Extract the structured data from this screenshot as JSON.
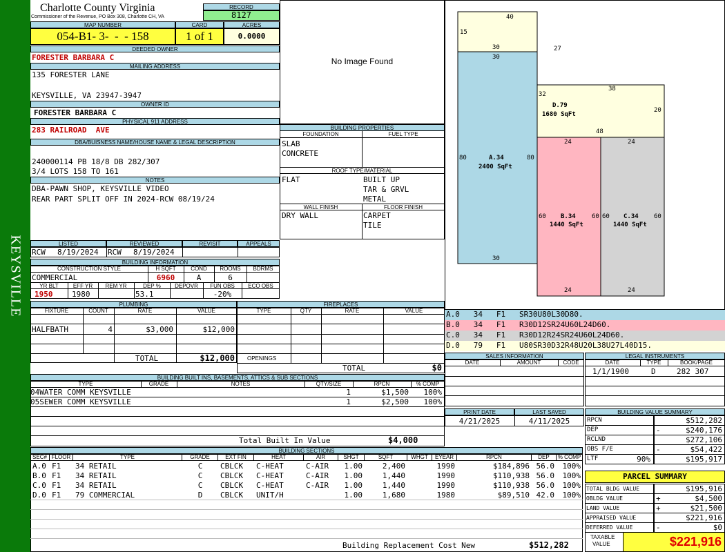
{
  "side_label": "KEYSVILLE",
  "header": {
    "county": "Charlotte County Virginia",
    "commissioner": "Commissioner of the Revenue, PO Box 308, Charlotte CH, VA",
    "record_label": "RECORD",
    "record": "8127"
  },
  "map": {
    "map_label": "MAP NUMBER",
    "map_number": "054-B1- 3-  -  - 158",
    "card_label": "CARD",
    "card": "1 of 1",
    "acres_label": "ACRES",
    "acres": "0.0000"
  },
  "owner": {
    "deeded_label": "DEEDED OWNER",
    "deeded_owner": "FORESTER BARBARA C",
    "mailing_label": "MAILING ADDRESS",
    "addr1": "135 FORESTER LANE",
    "addr2": "KEYSVILLE, VA 23947-3947",
    "owner_id_label": "OWNER ID",
    "owner_id": "FORESTER BARBARA C",
    "physical_label": "PHYSICAL 911 ADDRESS",
    "physical": "283 RAILROAD  AVE"
  },
  "legal": {
    "label": "DBA/BUISNESS NAME/HOUSE NAME & LEGAL DESCRIPTION",
    "line1": "240000114 PB 18/8 DB 282/307",
    "line2": "3/4 LOTS 158 TO 161"
  },
  "notes": {
    "label": "NOTES",
    "line1": "DBA-PAWN SHOP, KEYSVILLE VIDEO",
    "line2": "REAR PART SPLIT OFF IN 2024-RCW 08/19/24"
  },
  "image": {
    "text": "No Image Found"
  },
  "building_props": {
    "label": "BUILDING PROPERTIES",
    "foundation_label": "FOUNDATION",
    "fuel_label": "FUEL TYPE",
    "foundation1": "SLAB",
    "foundation2": "CONCRETE",
    "roof_label": "ROOF TYPE/MATERIAL",
    "roof1": "FLAT",
    "roof2": "BUILT UP",
    "roof3": "TAR & GRVL",
    "roof4": "METAL",
    "wall_label": "WALL FINISH",
    "floor_label": "FLOOR FINISH",
    "wall1": "DRY WALL",
    "floor1": "CARPET",
    "floor2": "TILE"
  },
  "review": {
    "listed_label": "LISTED",
    "reviewed_label": "REVIEWED",
    "revisit_label": "REVISIT",
    "appeals_label": "APPEALS",
    "listed_by": "RCW",
    "listed_date": "8/19/2024",
    "reviewed_by": "RCW",
    "reviewed_date": "8/19/2024"
  },
  "building_info": {
    "label": "BUILDING INFORMATION",
    "cs_label": "CONSTRUCTION STYLE",
    "hsqft_label": "H SQFT",
    "cond_label": "COND",
    "rooms_label": "ROOMS",
    "bdrms_label": "BDRMS",
    "style": "COMMERCIAL",
    "hsqft": "6960",
    "cond": "A",
    "rooms": "6",
    "yrblt_label": "YR BLT",
    "effyr_label": "EFF YR",
    "remyr_label": "REM YR",
    "dep_label": "DEP %",
    "depovr_label": "DEPOVR",
    "funobs_label": "FUN OBS",
    "ecoobs_label": "ECO OBS",
    "yrblt": "1950",
    "effyr": "1980",
    "dep": "53.1",
    "funobs": "-20%"
  },
  "plumbing": {
    "label": "PLUMBING",
    "h_fixture": "FIXTURE",
    "h_count": "COUNT",
    "h_rate": "RATE",
    "h_value": "VALUE",
    "fixture": "HALFBATH",
    "count": "4",
    "rate": "$3,000",
    "value": "$12,000",
    "total_label": "TOTAL",
    "total": "$12,000"
  },
  "fireplaces": {
    "label": "FIREPLACES",
    "h_type": "TYPE",
    "h_qty": "QTY",
    "h_rate": "RATE",
    "h_value": "VALUE",
    "openings_label": "OPENINGS",
    "total_label": "TOTAL",
    "total": "$0"
  },
  "builtins": {
    "label": "BUILDING BUILT INS, BASEMENTS, ATTICS & SUB SECTIONS",
    "h_type": "TYPE",
    "h_grade": "GRADE",
    "h_notes": "NOTES",
    "h_qty": "QTY/SIZE",
    "h_rpcn": "RPCN",
    "h_comp": "% COMP",
    "rows": [
      {
        "type": "04WATER COMM KEYSVILLE",
        "qty": "1",
        "rpcn": "$1,500",
        "comp": "100%"
      },
      {
        "type": "05SEWER COMM KEYSVILLE",
        "qty": "1",
        "rpcn": "$2,500",
        "comp": "100%"
      }
    ],
    "total_label": "Total Built In Value",
    "total": "$4,000"
  },
  "sections": {
    "label": "BUILDING SECTIONS",
    "headers": [
      "SEC#",
      "FLOOR",
      "TYPE",
      "GRADE",
      "EXT FIN",
      "HEAT",
      "AIR",
      "SHGT",
      "SQFT",
      "WHGT",
      "EYEAR",
      "RPCN",
      "DEP",
      "% COMP"
    ],
    "rows": [
      [
        "A.0",
        "F1",
        "34 RETAIL",
        "C",
        "CBLCK",
        "C-HEAT",
        "C-AIR",
        "1.00",
        "2,400",
        "",
        "1990",
        "$184,896",
        "56.0",
        "100%"
      ],
      [
        "B.0",
        "F1",
        "34 RETAIL",
        "C",
        "CBLCK",
        "C-HEAT",
        "C-AIR",
        "1.00",
        "1,440",
        "",
        "1990",
        "$110,938",
        "56.0",
        "100%"
      ],
      [
        "C.0",
        "F1",
        "34 RETAIL",
        "C",
        "CBLCK",
        "C-HEAT",
        "C-AIR",
        "1.00",
        "1,440",
        "",
        "1990",
        "$110,938",
        "56.0",
        "100%"
      ],
      [
        "D.0",
        "F1",
        "79 COMMERCIAL",
        "D",
        "CBLCK",
        "UNIT/H",
        "",
        "1.00",
        "1,680",
        "",
        "1980",
        "$89,510",
        "42.0",
        "100%"
      ]
    ],
    "brcn_label": "Building Replacement Cost New",
    "brcn": "$512,282"
  },
  "sketch": {
    "labels": [
      {
        "t": "40"
      },
      {
        "t": "15"
      },
      {
        "t": "30"
      },
      {
        "t": "27"
      },
      {
        "t": "30"
      },
      {
        "t": "32"
      },
      {
        "t": "38"
      },
      {
        "t": "D.79"
      },
      {
        "t": "1680 SqFt"
      },
      {
        "t": "20"
      },
      {
        "t": "48"
      },
      {
        "t": "24"
      },
      {
        "t": "24"
      },
      {
        "t": "80"
      },
      {
        "t": "A.34"
      },
      {
        "t": "2400 SqFt"
      },
      {
        "t": "80"
      },
      {
        "t": "60"
      },
      {
        "t": "B.34"
      },
      {
        "t": "60"
      },
      {
        "t": "60"
      },
      {
        "t": "C.34"
      },
      {
        "t": "60"
      },
      {
        "t": "1440 SqFt"
      },
      {
        "t": "1440 SqFt"
      },
      {
        "t": "30"
      },
      {
        "t": "24"
      },
      {
        "t": "24"
      }
    ],
    "colors": {
      "A": "#add8e6",
      "B": "#ffb6c1",
      "C": "#d3d3d3",
      "D": "#ffffe0"
    }
  },
  "calls": [
    {
      "text": "A.0   34   F1   SR30U80L30D80.",
      "color": "#add8e6"
    },
    {
      "text": "B.0   34   F1   R30D12SR24U60L24D60.",
      "color": "#ffb6c1"
    },
    {
      "text": "C.0   34   F1   R30D12R24SR24U60L24D60.",
      "color": "#d3d3d3"
    },
    {
      "text": "D.0   79   F1   U80SR30D32R48U20L38U27L40D15.",
      "color": "#ffffe0"
    }
  ],
  "sales": {
    "label": "SALES INFORMATION",
    "h_date": "DATE",
    "h_amount": "AMOUNT",
    "h_code": "CODE"
  },
  "legal_instr": {
    "label": "LEGAL INSTRUMENTS",
    "h_date": "DATE",
    "h_type": "TYPE",
    "h_book": "BOOK/PAGE",
    "date": "1/1/1900",
    "type": "D",
    "book": "282 307"
  },
  "print": {
    "print_label": "PRINT DATE",
    "saved_label": "LAST SAVED",
    "print_date": "4/21/2025",
    "saved_date": "4/11/2025"
  },
  "bvs": {
    "label": "BUILDING VALUE SUMMARY",
    "rows": [
      {
        "k": "RPCN",
        "s": "",
        "v": "$512,282"
      },
      {
        "k": "DEP",
        "s": "-",
        "v": "$240,176"
      },
      {
        "k": "RCLND",
        "s": "",
        "v": "$272,106"
      },
      {
        "k": "OBS F/E",
        "s": "-",
        "v": "$54,422"
      },
      {
        "k": "LTF",
        "p": "90%",
        "s": "",
        "v": "$195,917"
      }
    ]
  },
  "parcel": {
    "label": "PARCEL SUMMARY",
    "rows": [
      {
        "k": "TOTAL BLDG VALUE",
        "s": "",
        "v": "$195,916"
      },
      {
        "k": "OBLDG VALUE",
        "s": "+",
        "v": "$4,500"
      },
      {
        "k": "LAND VALUE",
        "s": "+",
        "v": "$21,500"
      },
      {
        "k": "APPRAISED VALUE",
        "s": "",
        "v": "$221,916"
      },
      {
        "k": "DEFERRED VALUE",
        "s": "-",
        "v": "$0"
      }
    ],
    "taxable_label1": "TAXABLE",
    "taxable_label2": "VALUE",
    "taxable": "$221,916"
  }
}
